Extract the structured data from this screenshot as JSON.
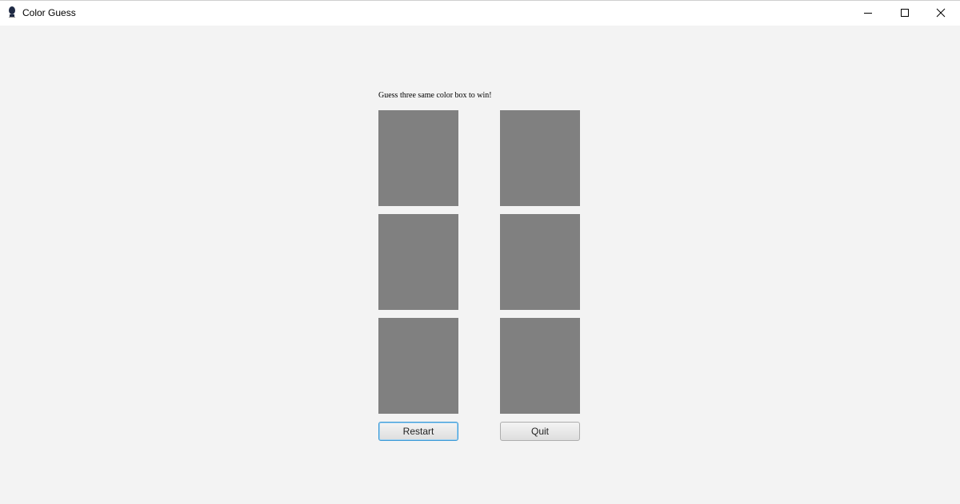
{
  "window": {
    "title": "Color Guess",
    "controls": {
      "minimize_icon": "minimize-icon",
      "maximize_icon": "maximize-icon",
      "close_icon": "close-icon"
    }
  },
  "game": {
    "instruction": "Guess three same color box to win!",
    "box_color": "#808080",
    "boxes": [
      {
        "color": "#808080"
      },
      {
        "color": "#808080"
      },
      {
        "color": "#808080"
      },
      {
        "color": "#808080"
      },
      {
        "color": "#808080"
      },
      {
        "color": "#808080"
      }
    ]
  },
  "buttons": {
    "restart_label": "Restart",
    "quit_label": "Quit"
  },
  "colors": {
    "background": "#f3f3f3",
    "titlebar": "#ffffff",
    "focus_accent": "#3c9ad6"
  }
}
